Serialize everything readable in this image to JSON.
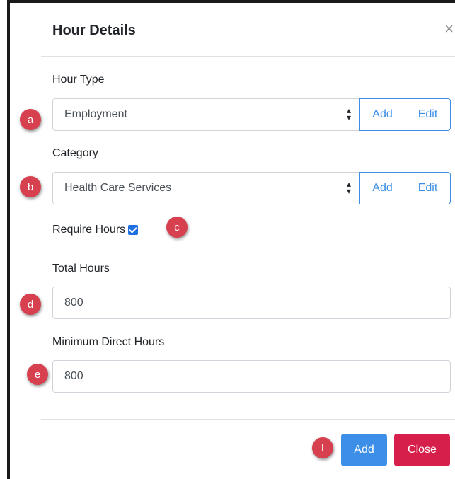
{
  "dialog": {
    "title": "Hour Details",
    "close_glyph": "×"
  },
  "hour_type": {
    "label": "Hour Type",
    "selected": "Employment",
    "add_label": "Add",
    "edit_label": "Edit",
    "marker": "a"
  },
  "category": {
    "label": "Category",
    "selected": "Health Care Services",
    "add_label": "Add",
    "edit_label": "Edit",
    "marker": "b"
  },
  "require_hours": {
    "label": "Require Hours",
    "checked": true,
    "marker": "c"
  },
  "total_hours": {
    "label": "Total Hours",
    "value": "800",
    "marker": "d"
  },
  "minimum_direct_hours": {
    "label": "Minimum Direct Hours",
    "value": "800",
    "marker": "e"
  },
  "footer": {
    "add_label": "Add",
    "close_label": "Close",
    "marker": "f"
  },
  "colors": {
    "primary": "#3c8ee6",
    "danger": "#d61f4a",
    "marker": "#d6404f",
    "checkbox": "#1f6fe0"
  },
  "icons": {
    "select_arrow": "sort-caret-icon",
    "close": "close-icon",
    "check": "checkmark-icon"
  }
}
